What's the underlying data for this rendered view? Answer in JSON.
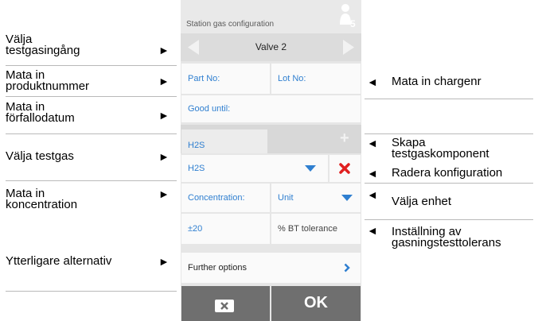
{
  "left_annotations": [
    {
      "lines": [
        "Välja",
        "testgasingång"
      ]
    },
    {
      "lines": [
        "Mata in",
        "produktnummer"
      ]
    },
    {
      "lines": [
        "Mata in",
        "förfallodatum"
      ]
    },
    {
      "lines": [
        "Välja testgas"
      ]
    },
    {
      "lines": [
        "Mata in",
        "koncentration"
      ]
    },
    {
      "lines": [
        "Ytterligare alternativ"
      ]
    }
  ],
  "right_annotations": [
    {
      "lines": [
        "Mata in chargenr"
      ]
    },
    {
      "lines": [
        "Skapa",
        "testgaskomponent"
      ]
    },
    {
      "lines": [
        "Radera konfiguration"
      ]
    },
    {
      "lines": [
        "Välja enhet"
      ]
    },
    {
      "lines": [
        "Inställning av",
        "gasningstesttolerans"
      ]
    }
  ],
  "arrows": {
    "right": "►",
    "left": "◄"
  },
  "header": {
    "title": "Station gas configuration",
    "badge_number": "5",
    "icon": "user-station-icon"
  },
  "valve": {
    "label": "Valve 2",
    "prev_icon": "triangle-left-icon",
    "next_icon": "triangle-right-icon"
  },
  "fields": {
    "part_no": "Part No:",
    "lot_no": "Lot No:",
    "good_until": "Good until:",
    "gas_tab": "H2S",
    "gas_select": "H2S",
    "concentration": "Concentration:",
    "unit": "Unit",
    "tolerance_value": "±20",
    "tolerance_label": "% BT tolerance",
    "further_options": "Further options"
  },
  "footer": {
    "cancel_icon": "close-icon",
    "ok_label": "OK"
  },
  "colors": {
    "accent": "#2f7fd0",
    "delete": "#e02020",
    "footer": "#6f6f6f",
    "panel": "#e6e6e6"
  }
}
